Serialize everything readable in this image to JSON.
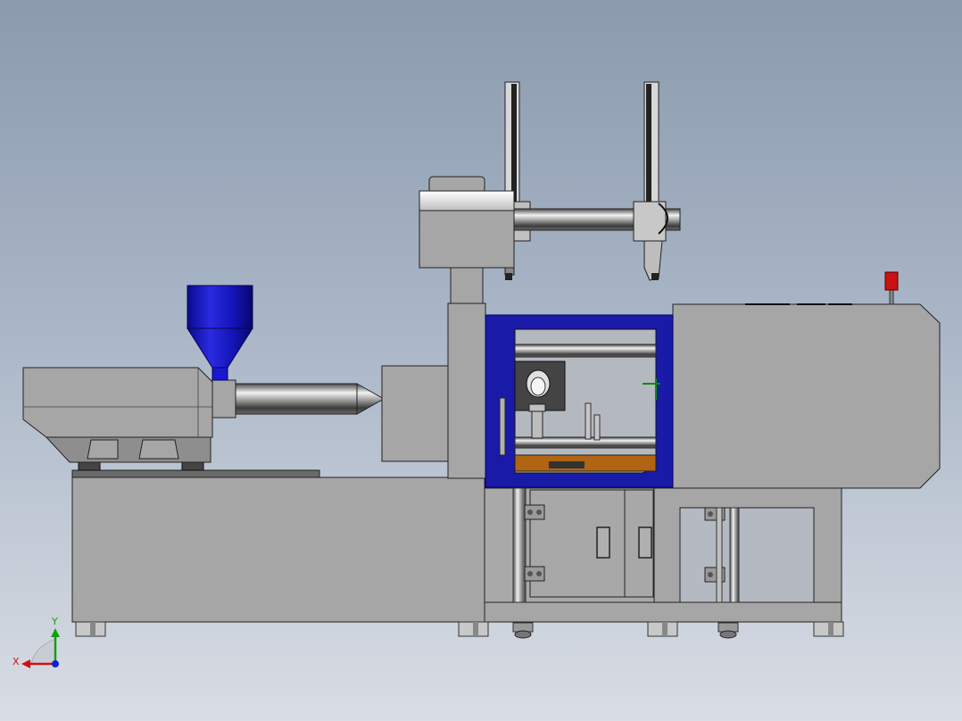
{
  "triad": {
    "x_label": "X",
    "y_label": "Y",
    "x_color": "#d01010",
    "y_color": "#10a010",
    "z_color": "#1020d0"
  },
  "colors": {
    "body_gray": "#a5a5a5",
    "edge": "#222222",
    "mold_frame_blue": "#1a1aa8",
    "hopper_blue": "#1515c8",
    "alarm_red": "#cc1111",
    "mold_base_orange": "#b06414"
  },
  "parts": [
    "injection-unit",
    "hopper",
    "barrel",
    "nozzle",
    "machine-base",
    "fixed-platen",
    "mold-area-frame",
    "clamp-unit",
    "robot-arm",
    "alarm-light",
    "cabinet-doors"
  ]
}
